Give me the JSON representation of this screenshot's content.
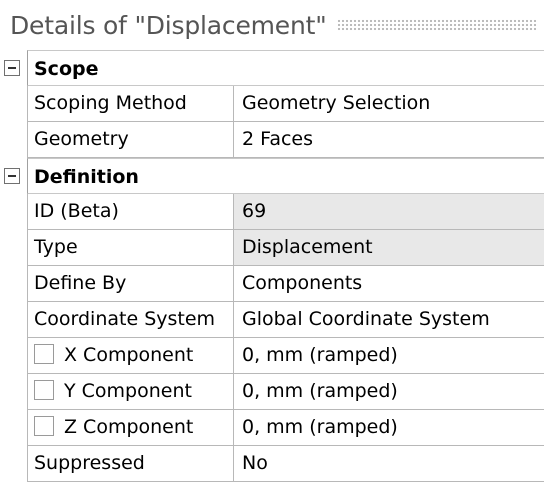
{
  "panel": {
    "title": "Details of \"Displacement\""
  },
  "groups": [
    {
      "label": "Scope",
      "rows": [
        {
          "name": "Scoping Method",
          "value": "Geometry Selection"
        },
        {
          "name": "Geometry",
          "value": "2 Faces"
        }
      ]
    },
    {
      "label": "Definition",
      "rows": [
        {
          "name": "ID (Beta)",
          "value": "69"
        },
        {
          "name": "Type",
          "value": "Displacement"
        },
        {
          "name": "Define By",
          "value": "Components"
        },
        {
          "name": "Coordinate System",
          "value": "Global Coordinate System"
        },
        {
          "name": "X Component",
          "value": "0, mm  (ramped)"
        },
        {
          "name": "Y Component",
          "value": "0, mm  (ramped)"
        },
        {
          "name": "Z Component",
          "value": "0, mm  (ramped)"
        },
        {
          "name": "Suppressed",
          "value": "No"
        }
      ]
    }
  ]
}
